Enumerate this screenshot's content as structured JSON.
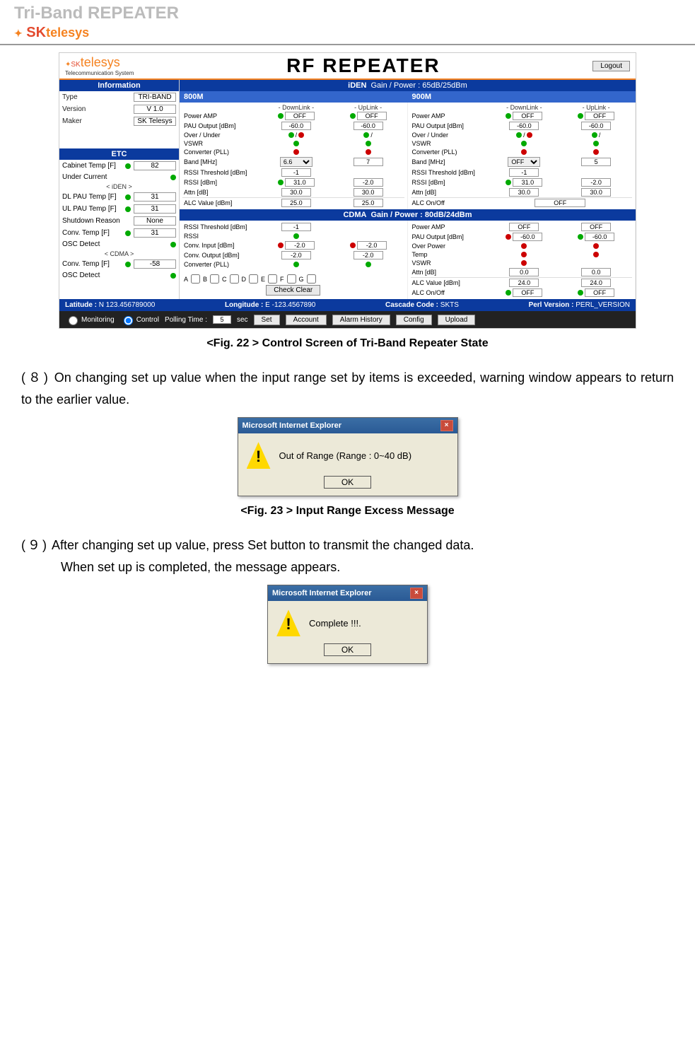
{
  "header": {
    "page_title": "Tri-Band REPEATER",
    "logo_sk": "SK",
    "logo_telesys": "telesys"
  },
  "app": {
    "title": "RF REPEATER",
    "logout": "Logout",
    "logo_sub": "Telecommunication System"
  },
  "sidebar": {
    "information": "Information",
    "type_lbl": "Type",
    "type_val": "TRI-BAND",
    "ver_lbl": "Version",
    "ver_val": "V 1.0",
    "maker_lbl": "Maker",
    "maker_val": "SK Telesys",
    "etc": "ETC",
    "cab_lbl": "Cabinet Temp [F]",
    "cab_val": "82",
    "under_lbl": "Under Current",
    "iden_sep": "< iDEN >",
    "dl_lbl": "DL PAU Temp [F]",
    "dl_val": "31",
    "ul_lbl": "UL PAU Temp [F]",
    "ul_val": "31",
    "shut_lbl": "Shutdown Reason",
    "shut_val": "None",
    "conv1_lbl": "Conv. Temp [F]",
    "conv1_val": "31",
    "osc1_lbl": "OSC Detect",
    "cdma_sep": "< CDMA >",
    "conv2_lbl": "Conv. Temp [F]",
    "conv2_val": "-58",
    "osc2_lbl": "OSC Detect"
  },
  "iden": {
    "label": "iDEN",
    "gp": "Gain / Power : 65dB/25dBm"
  },
  "band": {
    "b800": "800M",
    "b900": "900M",
    "dl": "- DownLink -",
    "ul": "- UpLink -"
  },
  "params": {
    "power_amp": "Power AMP",
    "pau_out": "PAU Output [dBm]",
    "over_under": "Over / Under",
    "vswr": "VSWR",
    "conv_pll": "Converter (PLL)",
    "band_mhz": "Band [MHz]",
    "rssi_th": "RSSI Threshold [dBm]",
    "rssi": "RSSI [dBm]",
    "attn": "Attn [dB]",
    "alc_val": "ALC Value [dBm]",
    "alc_onoff": "ALC On/Off",
    "over_power": "Over Power",
    "temp": "Temp",
    "conv_in": "Conv. Input [dBm]",
    "conv_out": "Conv. Output [dBm]",
    "check_clear": "Check Clear"
  },
  "vals": {
    "off": "OFF",
    "m60": "-60.0",
    "slash": "/",
    "b66": "6.6",
    "b7": "7",
    "b5": "5",
    "m1": "-1",
    "r31": "31.0",
    "m2": "-2.0",
    "a30": "30.0",
    "a25": "25.0",
    "a24": "24.0",
    "a0": "0.0",
    "letters": {
      "a": "A",
      "b": "B",
      "c": "C",
      "d": "D",
      "e": "E",
      "f": "F",
      "g": "G"
    }
  },
  "cdma": {
    "label": "CDMA",
    "gp": "Gain / Power : 80dB/24dBm"
  },
  "footer": {
    "lat_lbl": "Latitude :",
    "lat_val": "N 123.456789000",
    "lon_lbl": "Longitude :",
    "lon_val": "E -123.4567890",
    "casc_lbl": "Cascade Code :",
    "casc_val": "SKTS",
    "perl_lbl": "Perl Version :",
    "perl_val": "PERL_VERSION"
  },
  "control": {
    "monitoring": "Monitoring",
    "control": "Control",
    "polling_lbl": "Polling Time :",
    "polling_val": "5",
    "sec": "sec",
    "set": "Set",
    "account": "Account",
    "alarm": "Alarm History",
    "config": "Config",
    "upload": "Upload"
  },
  "captions": {
    "fig22": "<Fig. 22 > Control Screen of Tri-Band Repeater State",
    "fig23": "<Fig. 23 > Input Range Excess Message"
  },
  "body": {
    "p8num": "(８)",
    "p8": "On changing set up value when the input range set by items is exceeded, warning window appears to return to the earlier value.",
    "p9num": "(９)",
    "p9a": "After changing set up value, press Set button to transmit the changed data.",
    "p9b": "When set up is completed, the message appears."
  },
  "dialog1": {
    "title": "Microsoft Internet Explorer",
    "msg": "Out of Range (Range : 0~40 dB)",
    "ok": "OK"
  },
  "dialog2": {
    "title": "Microsoft Internet Explorer",
    "msg": "Complete !!!.",
    "ok": "OK"
  }
}
